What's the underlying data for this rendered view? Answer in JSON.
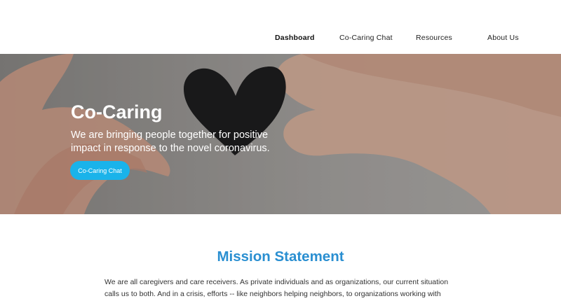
{
  "nav": {
    "items": [
      {
        "label": "Dashboard",
        "active": true
      },
      {
        "label": "Co-Caring Chat",
        "active": false
      },
      {
        "label": "Resources",
        "active": false
      },
      {
        "label": "About Us",
        "active": false
      }
    ]
  },
  "hero": {
    "title": "Co-Caring",
    "subtitle": "We are bringing people together for positive impact in response to the novel coronavirus.",
    "button_label": "Co-Caring Chat"
  },
  "mission": {
    "title": "Mission Statement",
    "text": "We are all caregivers and care receivers. As private individuals and as organizations, our current situation calls us to both. And in a crisis, efforts -- like neighbors helping neighbors, to organizations working with citizens"
  },
  "colors": {
    "accent": "#2a8fd1",
    "button": "#1ab3ea"
  }
}
